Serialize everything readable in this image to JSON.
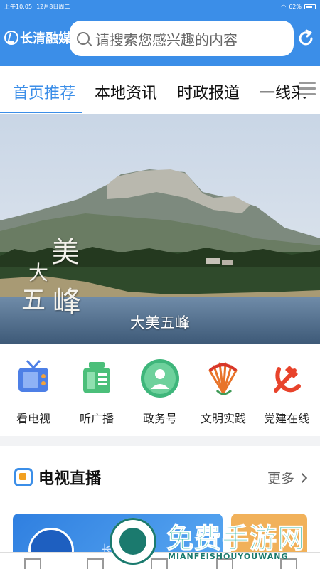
{
  "status": {
    "time": "上午10:05",
    "date": "12月8日周二",
    "battery": "62%"
  },
  "app": {
    "logo_text": "长清融媒",
    "search_placeholder": "请搜索您感兴趣的内容"
  },
  "tabs": [
    {
      "label": "首页推荐",
      "active": true
    },
    {
      "label": "本地资讯",
      "active": false
    },
    {
      "label": "时政报道",
      "active": false
    },
    {
      "label": "一线采",
      "active": false
    }
  ],
  "banner": {
    "caption": "大美五峰",
    "title_chars": [
      "美",
      "大",
      "五",
      "峰"
    ]
  },
  "services": [
    {
      "label": "看电视",
      "icon": "tv-icon"
    },
    {
      "label": "听广播",
      "icon": "radio-icon"
    },
    {
      "label": "政务号",
      "icon": "government-icon"
    },
    {
      "label": "文明实践",
      "icon": "civilization-icon"
    },
    {
      "label": "党建在线",
      "icon": "party-icon"
    }
  ],
  "live": {
    "title": "电视直播",
    "more": "更多",
    "card_text": "长清"
  },
  "watermark": {
    "main": "免费手游网",
    "sub": "MIANFEISHOUYOUWANG"
  },
  "colors": {
    "accent": "#3b8ee8",
    "watermark": "#2fb7a6"
  }
}
